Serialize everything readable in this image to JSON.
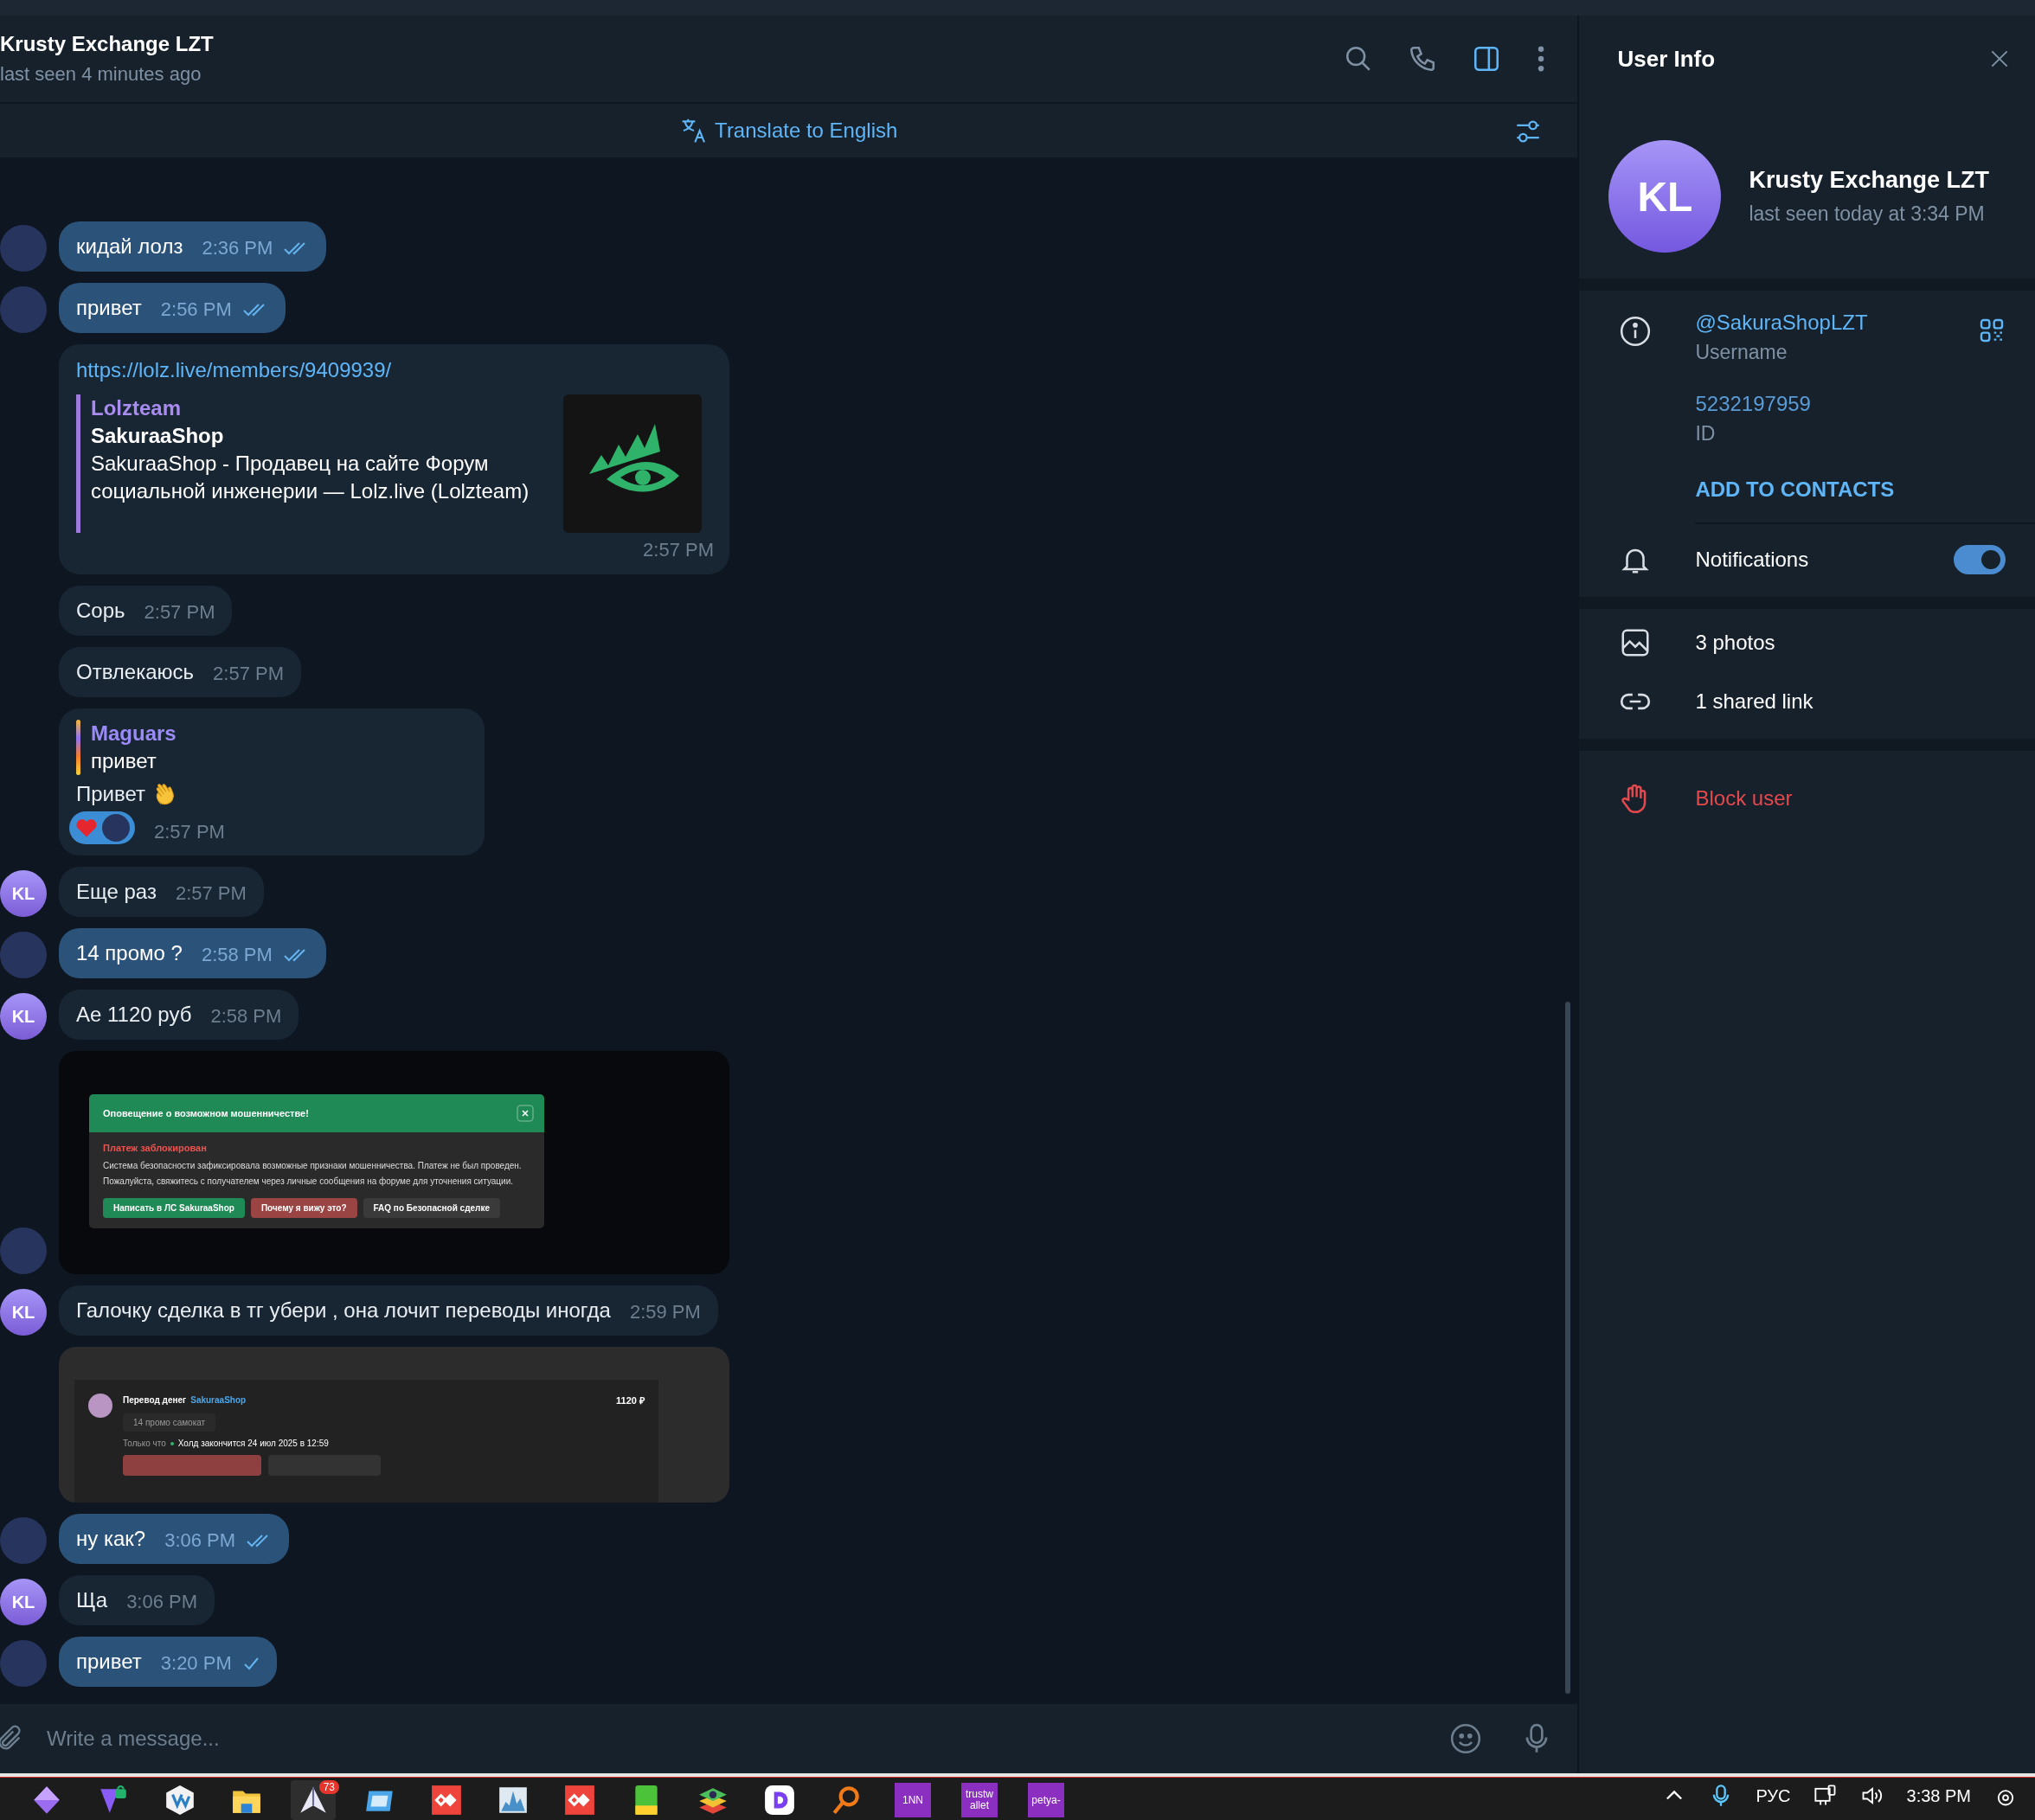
{
  "chat": {
    "title": "Krusty Exchange LZT",
    "status": "last seen 4 minutes ago",
    "header_icons": [
      {
        "kind": "search",
        "active": false
      },
      {
        "kind": "phone",
        "active": false
      },
      {
        "kind": "sidebar",
        "active": true
      },
      {
        "kind": "more",
        "active": false
      }
    ],
    "translate": "Translate to English",
    "messages": [
      {
        "kind": "text",
        "outgoing": true,
        "avatar": true,
        "text": "кидай лолз",
        "time": "2:36 PM",
        "read": true
      },
      {
        "kind": "text",
        "outgoing": true,
        "avatar": true,
        "text": "привет",
        "time": "2:56 PM",
        "read": true
      },
      {
        "kind": "link",
        "outgoing": false,
        "url": "https://lolz.live/members/9409939/",
        "site": "Lolzteam",
        "title": "SakuraaShop",
        "description": "SakuraaShop - Продавец на сайте Форум социальной инженерии —  Lolz.live (Lolzteam)",
        "time": "2:57 PM"
      },
      {
        "kind": "text",
        "outgoing": false,
        "text": "Сорь",
        "time": "2:57 PM"
      },
      {
        "kind": "text",
        "outgoing": false,
        "text": "Отвлекаюсь",
        "time": "2:57 PM"
      },
      {
        "kind": "reply",
        "outgoing": false,
        "reply_author": "Maguars",
        "reply_text": "привет",
        "text": "Привет",
        "time": "2:57 PM"
      },
      {
        "kind": "text",
        "outgoing": false,
        "avatar_initials": "KL",
        "text": "Еще раз",
        "time": "2:57 PM"
      },
      {
        "kind": "text",
        "outgoing": true,
        "avatar": true,
        "text": "14 промо ?",
        "time": "2:58 PM",
        "read": true
      },
      {
        "kind": "text",
        "outgoing": false,
        "avatar_initials": "KL",
        "text": "Ае 1120 руб",
        "time": "2:58 PM"
      },
      {
        "kind": "alert_screenshot",
        "avatar": true,
        "alert": {
          "title": "Оповещение о возможном мошенничестве!",
          "heading": "Платеж заблокирован",
          "body": "Система безопасности зафиксировала возможные признаки мошенничества. Платеж не был проведен. Пожалуйста, свяжитесь с получателем через личные сообщения на форуме для уточнения ситуации.",
          "buttons": [
            {
              "label": "Написать в ЛС SakuraaShop",
              "kind": "primary"
            },
            {
              "label": "Почему я вижу это?",
              "kind": "danger"
            },
            {
              "label": "FAQ по Безопасной сделке",
              "kind": "plain"
            }
          ]
        }
      },
      {
        "kind": "text",
        "outgoing": false,
        "avatar_initials": "KL",
        "text": "Галочку сделка в тг убери , она лочит переводы иногда",
        "time": "2:59 PM"
      },
      {
        "kind": "transfer_screenshot",
        "transfer": {
          "label": "Перевод денег",
          "recipient": "SakuraaShop",
          "amount": "1120 ₽",
          "tag": "14 промо самокат",
          "when": "Только что",
          "hold": "Холд закончится 24 июл 2025 в 12:59"
        }
      },
      {
        "kind": "text",
        "outgoing": true,
        "avatar": true,
        "text": "ну как?",
        "time": "3:06 PM",
        "read": true
      },
      {
        "kind": "text",
        "outgoing": false,
        "avatar_initials": "KL",
        "text": "Ща",
        "time": "3:06 PM"
      },
      {
        "kind": "text",
        "outgoing": true,
        "avatar": true,
        "text": "привет",
        "time": "3:20 PM",
        "read": false
      }
    ],
    "composer": {
      "placeholder": "Write a message..."
    }
  },
  "user_info": {
    "title": "User Info",
    "initials": "KL",
    "name": "Krusty Exchange LZT",
    "status": "last seen today at 3:34 PM",
    "username": "@SakuraShopLZT",
    "username_label": "Username",
    "id": "5232197959",
    "id_label": "ID",
    "add_contact": "ADD TO CONTACTS",
    "notifications": {
      "label": "Notifications",
      "on": true
    },
    "media": [
      {
        "kind": "photos",
        "label": "3 photos"
      },
      {
        "kind": "link",
        "label": "1 shared link"
      }
    ],
    "block": "Block user"
  },
  "taskbar": {
    "apps": [
      {
        "kind": "gem"
      },
      {
        "kind": "vpn"
      },
      {
        "kind": "veracrypt"
      },
      {
        "kind": "folder"
      },
      {
        "kind": "plane",
        "badge": "73",
        "active": true
      },
      {
        "kind": "window"
      },
      {
        "kind": "anydesk"
      },
      {
        "kind": "monitor"
      },
      {
        "kind": "anydesk"
      },
      {
        "kind": "book"
      },
      {
        "kind": "stack"
      },
      {
        "kind": "dapp"
      },
      {
        "kind": "magnifier"
      },
      {
        "kind": "label",
        "label": "1NN"
      },
      {
        "kind": "label",
        "label": "trustw\nallet"
      },
      {
        "kind": "label",
        "label": "petya-"
      }
    ],
    "language": "РУС",
    "time": "3:38 PM"
  }
}
